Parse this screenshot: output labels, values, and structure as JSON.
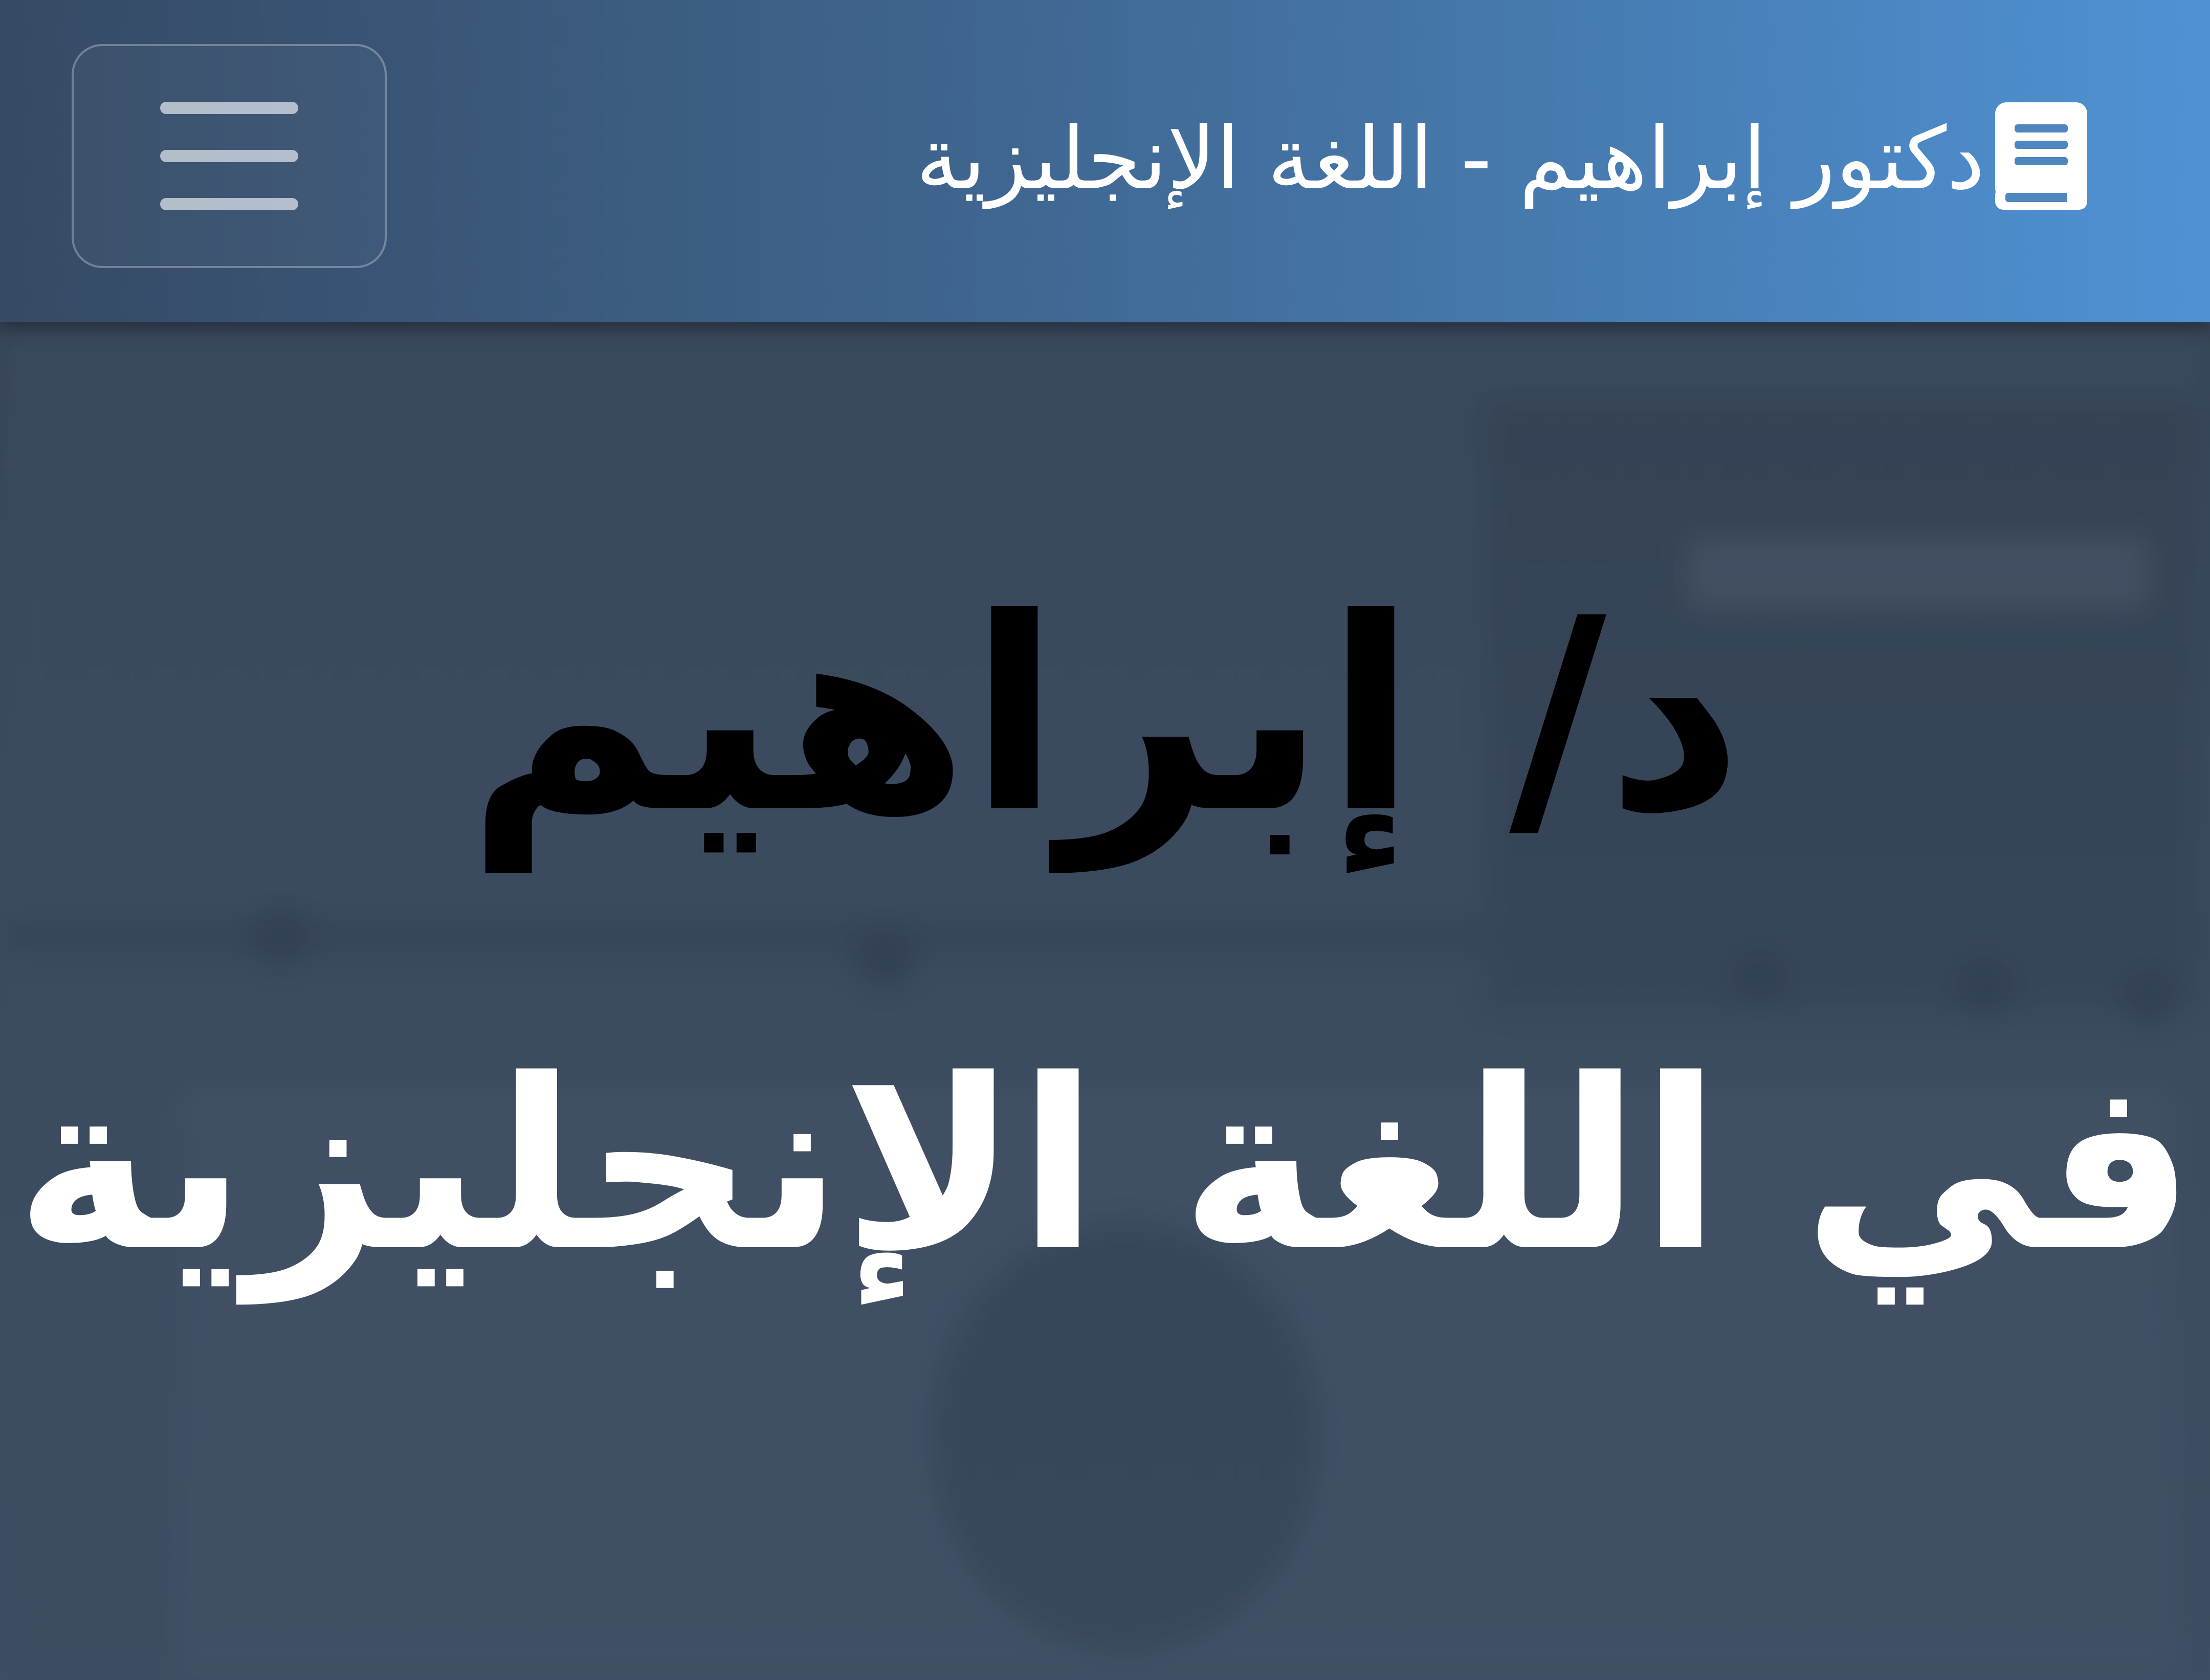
{
  "header": {
    "brand_icon": "book-icon",
    "brand_title": "دكتور إبراهيم - اللغة الإنجليزية",
    "menu_icon": "hamburger-menu-icon"
  },
  "hero": {
    "title": "د/ إبراهيم",
    "subtitle": "في اللغة الإنجليزية"
  },
  "colors": {
    "header_start": "#354a64",
    "header_end": "#4f92d4",
    "hero_bg": "#46576d",
    "title_color": "#000000",
    "subtitle_color": "#ffffff"
  }
}
